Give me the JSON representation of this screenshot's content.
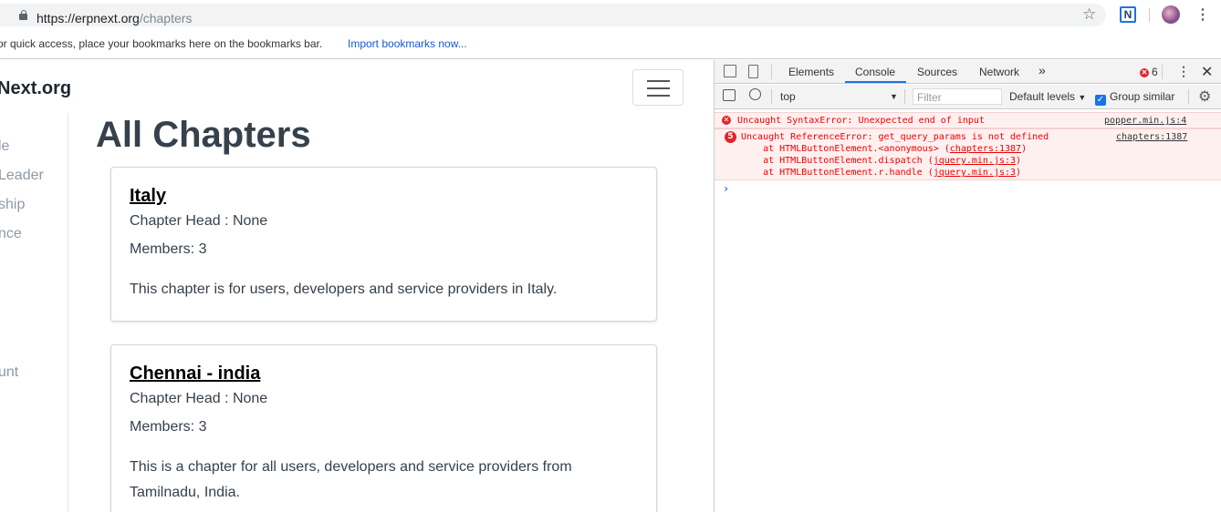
{
  "browser": {
    "url_host": "https://erpnext.org",
    "url_path": "/chapters",
    "bookmarks_message": "or quick access, place your bookmarks here on the bookmarks bar.",
    "import_bookmarks": "Import bookmarks now...",
    "extension_letter": "N"
  },
  "site": {
    "brand": "Next.org",
    "sidebar": [
      "le",
      "Leader",
      "ship",
      "nce",
      "unt"
    ],
    "title": "All Chapters",
    "chapters": [
      {
        "name": "Italy",
        "head": "Chapter Head : None",
        "members": "Members: 3",
        "description": "This chapter is for users, developers and service providers in Italy."
      },
      {
        "name": "Chennai - india",
        "head": "Chapter Head : None",
        "members": "Members: 3",
        "description": "This is a chapter for all users, developers and service providers from Tamilnadu, India."
      }
    ]
  },
  "devtools": {
    "tabs": [
      "Elements",
      "Console",
      "Sources",
      "Network"
    ],
    "active_tab": "Console",
    "error_count": "6",
    "context": "top",
    "filter_placeholder": "Filter",
    "levels": "Default levels",
    "group_similar": "Group similar",
    "messages": [
      {
        "count": "",
        "text": "Uncaught SyntaxError: Unexpected end of input",
        "source": "popper.min.js:4"
      },
      {
        "count": "5",
        "text": "Uncaught ReferenceError: get_query_params is not defined",
        "source": "chapters:1387",
        "stack": [
          {
            "prefix": "    at HTMLButtonElement.<anonymous> (",
            "link": "chapters:1387",
            "suffix": ")"
          },
          {
            "prefix": "    at HTMLButtonElement.dispatch (",
            "link": "jquery.min.js:3",
            "suffix": ")"
          },
          {
            "prefix": "    at HTMLButtonElement.r.handle (",
            "link": "jquery.min.js:3",
            "suffix": ")"
          }
        ]
      }
    ],
    "prompt": "›"
  },
  "colors": {
    "error": "#e0262b",
    "accent": "#1a73e8"
  }
}
